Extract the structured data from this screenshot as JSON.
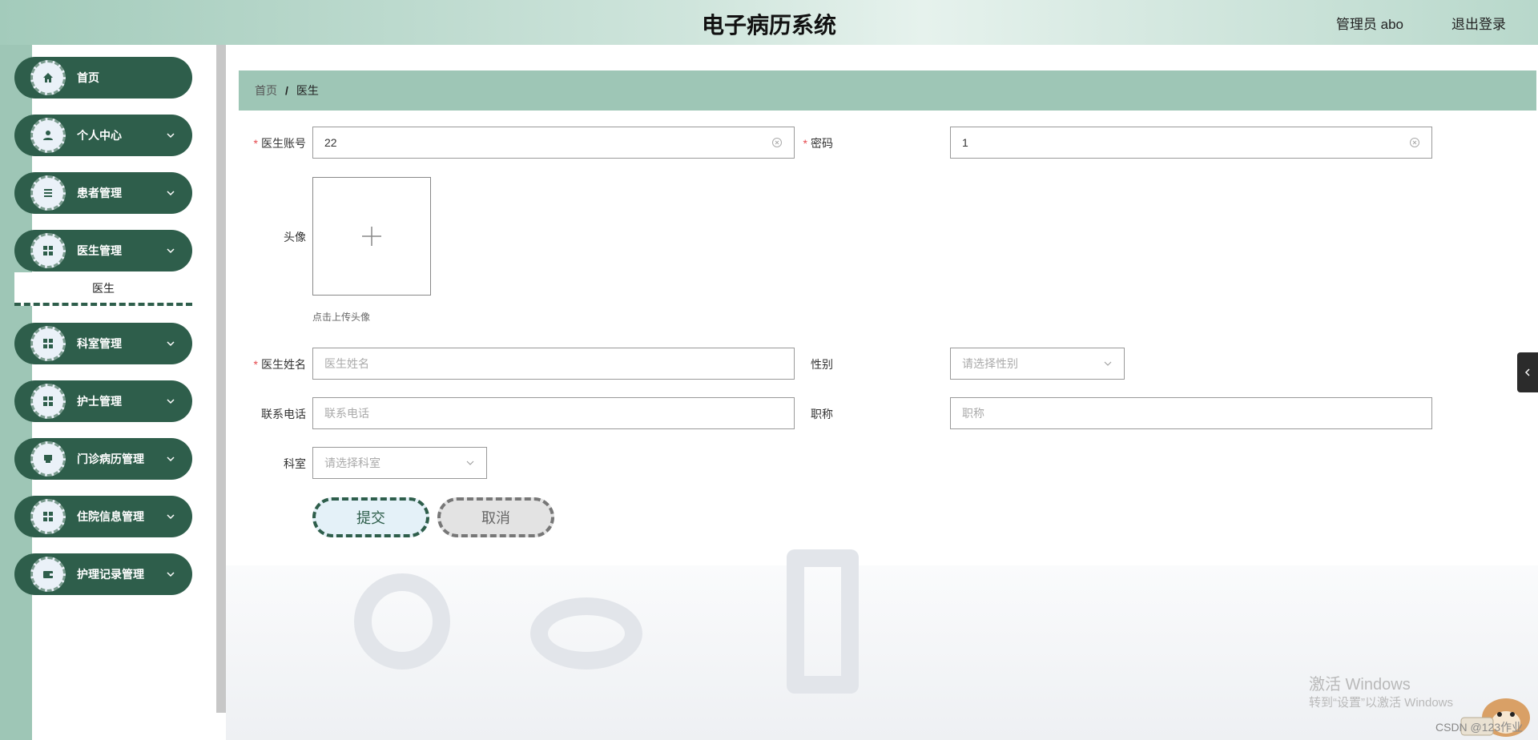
{
  "header": {
    "title": "电子病历系统",
    "user": "管理员 abo",
    "logout": "退出登录"
  },
  "sidebar": {
    "items": [
      {
        "label": "首页",
        "icon": "home-icon",
        "has_arrow": false
      },
      {
        "label": "个人中心",
        "icon": "user-icon",
        "has_arrow": true
      },
      {
        "label": "患者管理",
        "icon": "list-icon",
        "has_arrow": true
      },
      {
        "label": "医生管理",
        "icon": "grid-icon",
        "has_arrow": true
      },
      {
        "label": "科室管理",
        "icon": "grid-icon",
        "has_arrow": true
      },
      {
        "label": "护士管理",
        "icon": "grid-icon",
        "has_arrow": true
      },
      {
        "label": "门诊病历管理",
        "icon": "printer-icon",
        "has_arrow": true
      },
      {
        "label": "住院信息管理",
        "icon": "grid-icon",
        "has_arrow": true
      },
      {
        "label": "护理记录管理",
        "icon": "wallet-icon",
        "has_arrow": true
      }
    ],
    "submenu": "医生"
  },
  "breadcrumb": {
    "home": "首页",
    "separator": "/",
    "current": "医生"
  },
  "form": {
    "account": {
      "label": "医生账号",
      "value": "22"
    },
    "password": {
      "label": "密码",
      "value": "1"
    },
    "avatar": {
      "label": "头像",
      "tip": "点击上传头像"
    },
    "name": {
      "label": "医生姓名",
      "placeholder": "医生姓名"
    },
    "gender": {
      "label": "性别",
      "placeholder": "请选择性别"
    },
    "phone": {
      "label": "联系电话",
      "placeholder": "联系电话"
    },
    "title": {
      "label": "职称",
      "placeholder": "职称"
    },
    "department": {
      "label": "科室",
      "placeholder": "请选择科室"
    },
    "submit": "提交",
    "cancel": "取消"
  },
  "overlay": {
    "activate_title": "激活 Windows",
    "activate_tip": "转到“设置”以激活 Windows",
    "csdn": "CSDN @123作业"
  },
  "colors": {
    "accent": "#2e5e4b",
    "breadcrumb_bg": "#9ec6b6",
    "required": "#e5484d"
  }
}
